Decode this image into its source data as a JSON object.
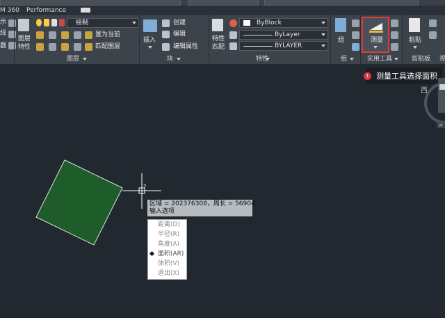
{
  "header": {
    "tabs": [
      {
        "label": "M 360"
      },
      {
        "label": "Performance"
      }
    ]
  },
  "ribbon": {
    "left_group": {
      "labels": [
        "示",
        "线",
        "器",
        "图层",
        "特性"
      ]
    },
    "layers": {
      "layer_name": "绘制",
      "set_current": "置为当前",
      "match_layer": "匹配图层",
      "panel_title": "图层"
    },
    "block": {
      "insert": "插入",
      "create": "创建",
      "edit": "编辑",
      "edit_attributes": "编辑属性",
      "panel_title": "块"
    },
    "properties": {
      "match_top": "特性",
      "match_bottom": "匹配",
      "color": "ByBlock",
      "linetype": "ByLayer",
      "lineweight": "BYLAYER",
      "panel_title": "特性"
    },
    "groups": {
      "group_label": "组",
      "panel_title": "组"
    },
    "utilities": {
      "measure_label": "测量",
      "panel_title": "实用工具"
    },
    "clipboard": {
      "paste_label": "粘贴",
      "panel_title": "剪贴板"
    },
    "view_panel_title": "视"
  },
  "tooltip": {
    "badge": "1",
    "text": "测量工具选择面积"
  },
  "canvas": {
    "cursor_label": "?",
    "measure_result": "区域 = 202376308，周长 = 56904",
    "prompt": "输入选项",
    "menu": [
      {
        "label": "距离(D)",
        "active": false
      },
      {
        "label": "半径(R)",
        "active": false
      },
      {
        "label": "角度(A)",
        "active": false
      },
      {
        "label": "面积(AR)",
        "active": true
      },
      {
        "label": "体积(V)",
        "active": false
      },
      {
        "label": "退出(X)",
        "active": false
      }
    ],
    "viewcube_label": "西",
    "viewcube_wcs": "W"
  },
  "colors": {
    "background": "#212830",
    "shape_fill": "#1e5c2a",
    "highlight": "#e43b3b"
  }
}
